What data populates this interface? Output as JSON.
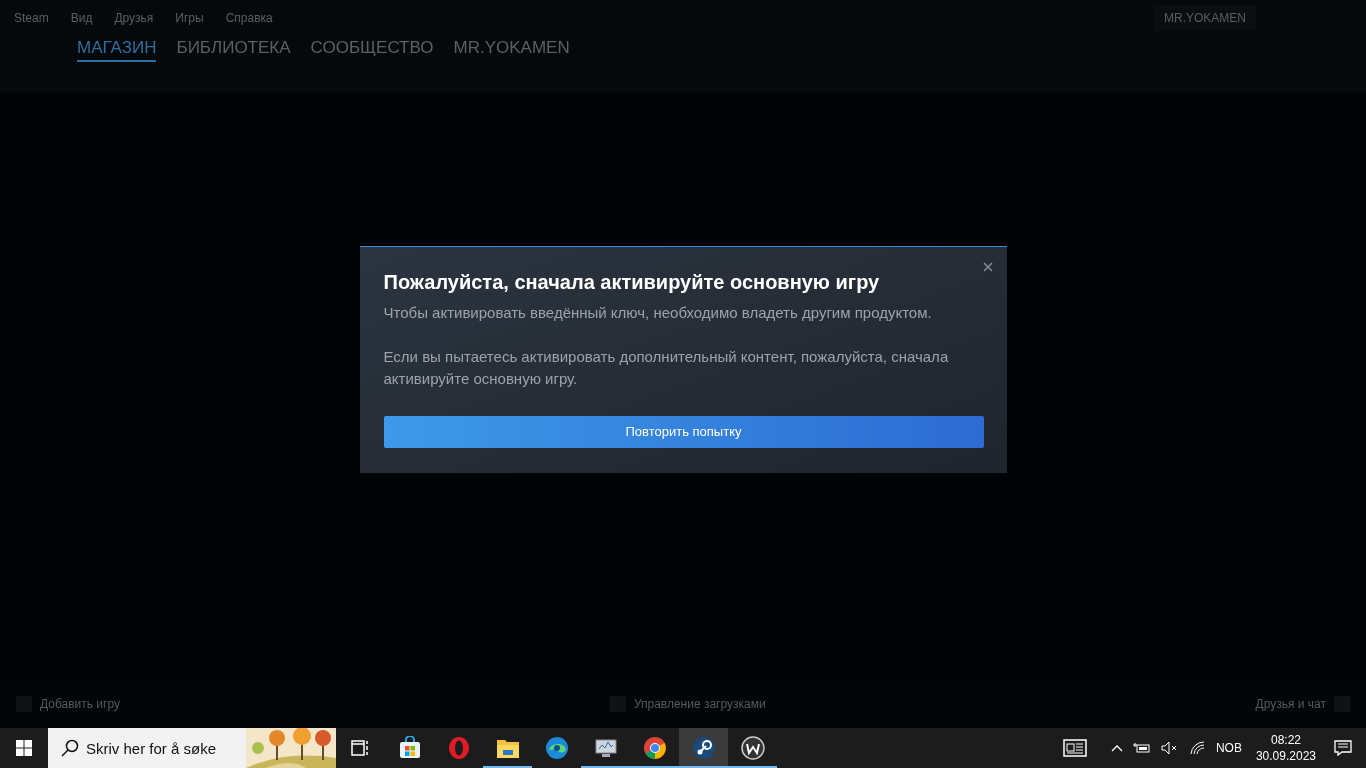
{
  "steam": {
    "menu": [
      "Steam",
      "Вид",
      "Друзья",
      "Игры",
      "Справка"
    ],
    "account": "MR.YOKAMEN",
    "nav": [
      {
        "label": "МАГАЗИН",
        "selected": true
      },
      {
        "label": "БИБЛИОТЕКА",
        "selected": false
      },
      {
        "label": "СООБЩЕСТВО",
        "selected": false
      },
      {
        "label": "MR.YOKAMEN",
        "selected": false
      }
    ],
    "footer": {
      "add_game": "Добавить игру",
      "downloads": "Управление загрузками",
      "friends": "Друзья и чат"
    }
  },
  "dialog": {
    "title": "Пожалуйста, сначала активируйте основную игру",
    "paragraphs": [
      "Чтобы активировать введённый ключ, необходимо владеть другим продуктом.",
      "Если вы пытаетесь активировать дополнительный контент, пожалуйста, сначала активируйте основную игру."
    ],
    "button": "Повторить попытку"
  },
  "taskbar": {
    "search": {
      "placeholder": "Skriv her for å søke"
    },
    "apps": [
      {
        "kind": "taskview",
        "running": false,
        "selected": false
      },
      {
        "kind": "store",
        "running": false,
        "selected": false
      },
      {
        "kind": "opera",
        "running": false,
        "selected": false
      },
      {
        "kind": "explorer",
        "running": true,
        "selected": false
      },
      {
        "kind": "edge",
        "running": false,
        "selected": false
      },
      {
        "kind": "monitor",
        "running": true,
        "selected": false
      },
      {
        "kind": "chrome",
        "running": true,
        "selected": false
      },
      {
        "kind": "steam",
        "running": true,
        "selected": true
      },
      {
        "kind": "wapp",
        "running": true,
        "selected": false
      }
    ],
    "language": "NOB",
    "time": "08:22",
    "date": "30.09.2023"
  }
}
